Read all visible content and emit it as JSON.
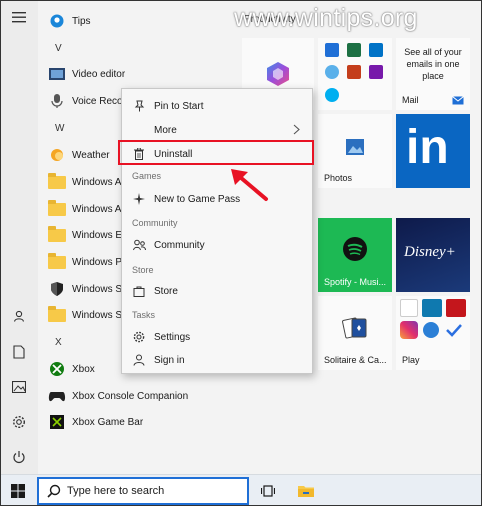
{
  "watermark": "www.wintips.org",
  "tiles_header": "Productivity",
  "app_list": {
    "tips": "Tips",
    "letter_v": "V",
    "video_editor": "Video editor",
    "voice_recorder": "Voice Recorde",
    "letter_w": "W",
    "weather": "Weather",
    "win_acc1": "Windows Ac",
    "win_acc2": "Windows Ac",
    "win_ease": "Windows Ea",
    "win_power": "Windows Po",
    "win_sec": "Windows Se",
    "win_sys": "Windows Sys",
    "letter_x": "X",
    "xbox": "Xbox",
    "xbox_console": "Xbox Console Companion",
    "xbox_gamebar": "Xbox Game Bar"
  },
  "context_menu": {
    "pin_to_start": "Pin to Start",
    "more": "More",
    "uninstall": "Uninstall",
    "games_header": "Games",
    "new_game_pass": "New to Game Pass",
    "community_header": "Community",
    "community": "Community",
    "store_header": "Store",
    "store": "Store",
    "tasks_header": "Tasks",
    "settings": "Settings",
    "sign_in": "Sign in"
  },
  "tiles": {
    "mail_text": "See all of your emails in one place",
    "mail_label": "Mail",
    "photos_label": "Photos",
    "spotify_label": "Spotify - Musi...",
    "disney_label": "Disney+",
    "solitaire_label": "Solitaire & Ca...",
    "play_label": "Play"
  },
  "taskbar": {
    "search_placeholder": "Type here to search"
  },
  "colors": {
    "highlight_red": "#e81224",
    "linkedin_blue": "#0a66c2",
    "spotify_green": "#1db954",
    "disney_navy": "#0e1a4a",
    "search_border": "#1f6fd6"
  }
}
